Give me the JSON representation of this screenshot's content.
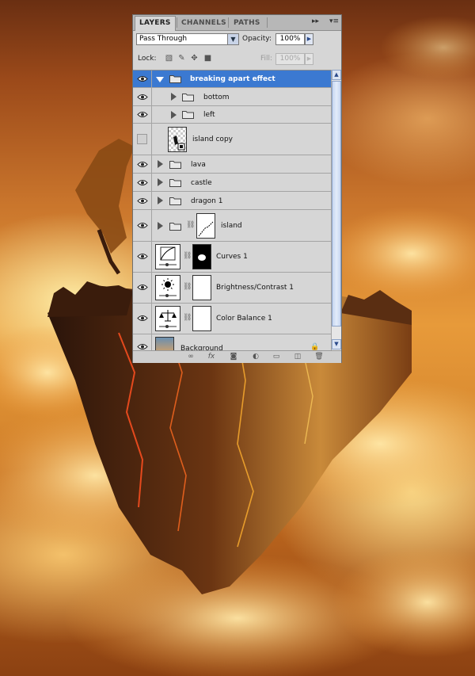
{
  "panel": {
    "tabs": [
      {
        "label": "LAYERS",
        "active": true
      },
      {
        "label": "CHANNELS",
        "active": false
      },
      {
        "label": "PATHS",
        "active": false
      }
    ],
    "collapse_icon": "double-arrow-icon",
    "menu_icon": "panel-menu-icon",
    "blend_mode": "Pass Through",
    "opacity_label": "Opacity:",
    "opacity_value": "100%",
    "lock_label": "Lock:",
    "lock_icons": [
      "lock-transparent-icon",
      "lock-image-icon",
      "lock-position-icon",
      "lock-all-icon"
    ],
    "fill_label": "Fill:",
    "fill_value": "100%",
    "layers": [
      {
        "name": "breaking apart effect",
        "kind": "group",
        "expanded": true,
        "selected": true,
        "visible": true,
        "indent": 0
      },
      {
        "name": "bottom",
        "kind": "group",
        "expanded": false,
        "selected": false,
        "visible": true,
        "indent": 1
      },
      {
        "name": "left",
        "kind": "group",
        "expanded": false,
        "selected": false,
        "visible": true,
        "indent": 1
      },
      {
        "name": "island copy",
        "kind": "smart-object",
        "selected": false,
        "visible": false,
        "indent": 1
      },
      {
        "name": "lava",
        "kind": "group",
        "expanded": false,
        "selected": false,
        "visible": true,
        "indent": 0
      },
      {
        "name": "castle",
        "kind": "group",
        "expanded": false,
        "selected": false,
        "visible": true,
        "indent": 0
      },
      {
        "name": "dragon 1",
        "kind": "group",
        "expanded": false,
        "selected": false,
        "visible": true,
        "indent": 0
      },
      {
        "name": "island",
        "kind": "masked-group",
        "expanded": false,
        "selected": false,
        "visible": true,
        "indent": 0
      },
      {
        "name": "Curves 1",
        "kind": "adjustment",
        "icon": "curves-icon",
        "selected": false,
        "visible": true,
        "indent": 0
      },
      {
        "name": "Brightness/Contrast 1",
        "kind": "adjustment",
        "icon": "brightness-contrast-icon",
        "selected": false,
        "visible": true,
        "indent": 0
      },
      {
        "name": "Color Balance 1",
        "kind": "adjustment",
        "icon": "color-balance-icon",
        "selected": false,
        "visible": true,
        "indent": 0
      },
      {
        "name": "Background",
        "kind": "background",
        "selected": false,
        "visible": true,
        "indent": 0
      }
    ],
    "footer_icons": [
      "link-layers-icon",
      "layer-style-fx-icon",
      "add-mask-icon",
      "adjustment-layer-icon",
      "new-group-icon",
      "new-layer-icon",
      "delete-layer-icon"
    ],
    "colors": {
      "selection": "#3b79d1",
      "panel_bg": "#d6d6d6"
    }
  }
}
